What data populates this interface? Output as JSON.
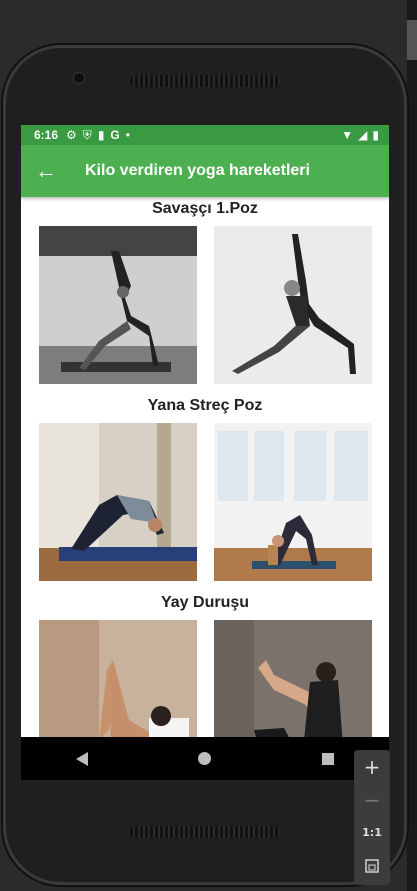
{
  "status": {
    "time": "6:16",
    "icons": [
      "settings-icon",
      "shield-icon",
      "sd-card-icon",
      "google-icon",
      "dot-icon"
    ]
  },
  "appbar": {
    "title": "Kilo verdiren yoga hareketleri"
  },
  "sections": [
    {
      "title": "Savaşçı 1.Poz"
    },
    {
      "title": "Yana Streç Poz"
    },
    {
      "title": "Yay Duruşu"
    }
  ],
  "emulator": {
    "plus": "+",
    "minus": "−",
    "ratio": "1:1"
  },
  "colors": {
    "appbar": "#4caf50",
    "statusbar": "#3a9a42"
  }
}
